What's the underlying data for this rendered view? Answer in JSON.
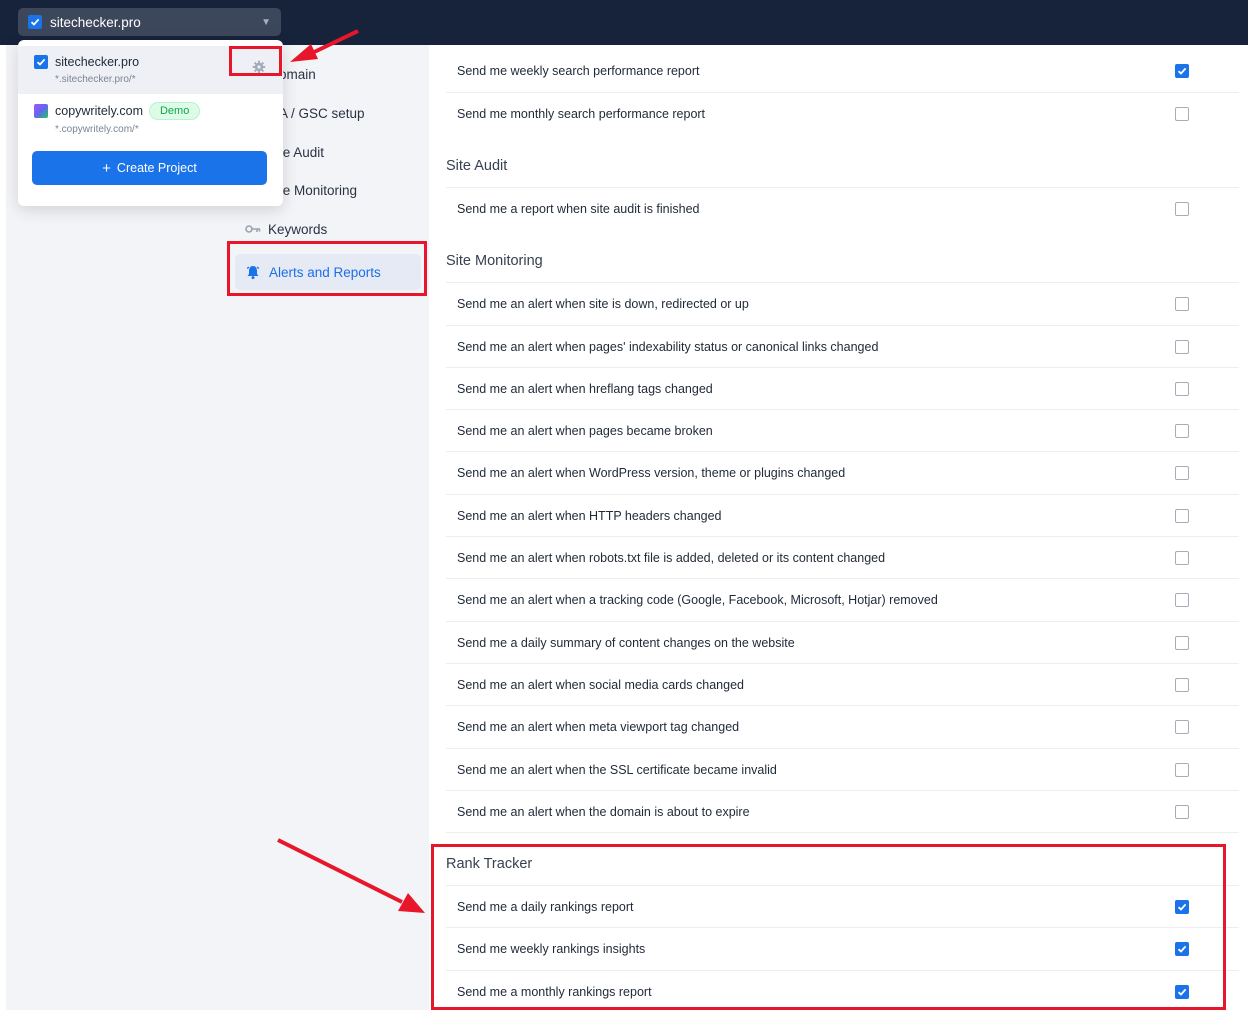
{
  "topbar": {
    "project_name": "sitechecker.pro",
    "chevron": "chevron-down-icon"
  },
  "dropdown": {
    "projects": [
      {
        "name": "sitechecker.pro",
        "domain": "*.sitechecker.pro/*",
        "icon": "sitechecker-logo"
      },
      {
        "name": "copywritely.com",
        "domain": "*.copywritely.com/*",
        "badge": "Demo",
        "icon": "copywritely-logo"
      }
    ],
    "create_label": "Create Project",
    "settings_icon": "gear-icon"
  },
  "nav": {
    "items": [
      {
        "label": "omain"
      },
      {
        "label": "A / GSC setup"
      },
      {
        "label": "te Audit"
      },
      {
        "label": "te Monitoring"
      },
      {
        "label": "Keywords",
        "icon": "key-icon"
      }
    ],
    "active": {
      "label": "Alerts and Reports",
      "icon": "bell-icon"
    }
  },
  "sections": {
    "search": {
      "rows": [
        {
          "label": "Send me weekly search performance report",
          "checked": true
        },
        {
          "label": "Send me monthly search performance report",
          "checked": false
        }
      ]
    },
    "site_audit": {
      "title": "Site Audit",
      "rows": [
        {
          "label": "Send me a report when site audit is finished",
          "checked": false
        }
      ]
    },
    "site_monitoring": {
      "title": "Site Monitoring",
      "rows": [
        {
          "label": "Send me an alert when site is down, redirected or up",
          "checked": false
        },
        {
          "label": "Send me an alert when pages' indexability status or canonical links changed",
          "checked": false
        },
        {
          "label": "Send me an alert when hreflang tags changed",
          "checked": false
        },
        {
          "label": "Send me an alert when pages became broken",
          "checked": false
        },
        {
          "label": "Send me an alert when WordPress version, theme or plugins changed",
          "checked": false
        },
        {
          "label": "Send me an alert when HTTP headers changed",
          "checked": false
        },
        {
          "label": "Send me an alert when robots.txt file is added, deleted or its content changed",
          "checked": false
        },
        {
          "label": "Send me an alert when a tracking code (Google, Facebook, Microsoft, Hotjar) removed",
          "checked": false
        },
        {
          "label": "Send me a daily summary of content changes on the website",
          "checked": false
        },
        {
          "label": "Send me an alert when social media cards changed",
          "checked": false
        },
        {
          "label": "Send me an alert when meta viewport tag changed",
          "checked": false
        },
        {
          "label": "Send me an alert when the SSL certificate became invalid",
          "checked": false
        },
        {
          "label": "Send me an alert when the domain is about to expire",
          "checked": false
        }
      ]
    },
    "rank_tracker": {
      "title": "Rank Tracker",
      "rows": [
        {
          "label": "Send me a daily rankings report",
          "checked": true
        },
        {
          "label": "Send me weekly rankings insights",
          "checked": true
        },
        {
          "label": "Send me a monthly rankings report",
          "checked": true
        }
      ]
    }
  },
  "colors": {
    "accent": "#1a73e8",
    "topbar": "#16233b",
    "highlight": "#e8162b",
    "demo_badge": "#16a34a"
  }
}
